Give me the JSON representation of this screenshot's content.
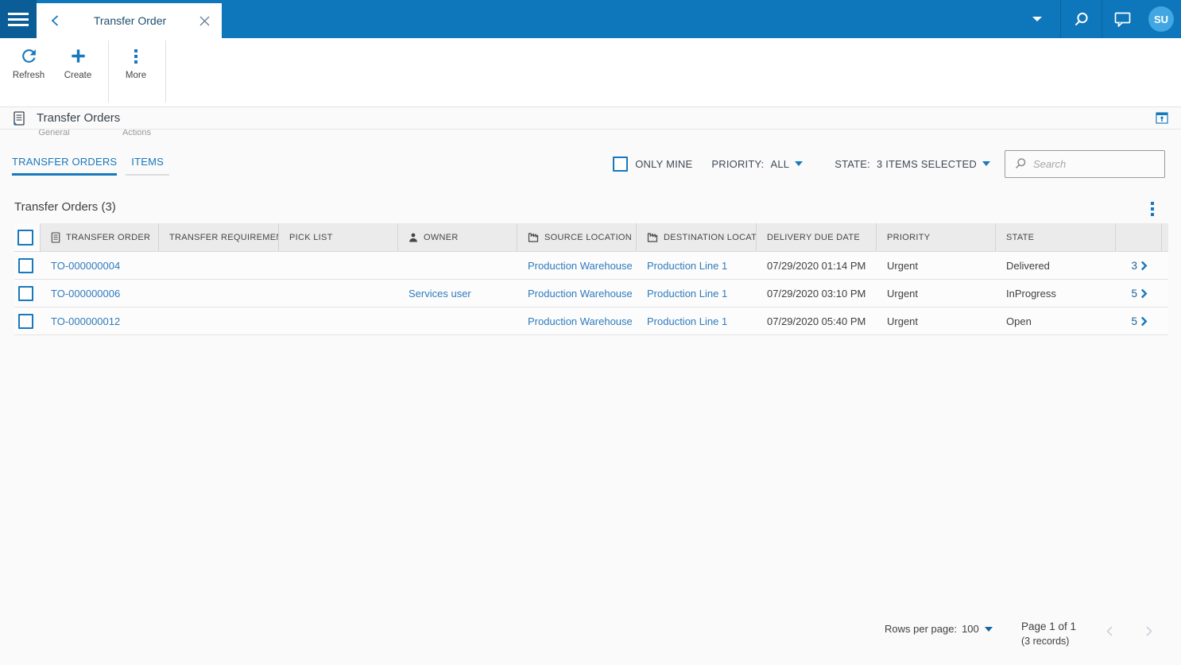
{
  "topbar": {
    "tab_title": "Transfer Order",
    "avatar_initials": "SU"
  },
  "ribbon": {
    "buttons": [
      {
        "label": "Refresh"
      },
      {
        "label": "Create"
      },
      {
        "label": "More"
      }
    ],
    "groups": [
      {
        "label": "General"
      },
      {
        "label": "Actions"
      }
    ]
  },
  "page": {
    "title": "Transfer Orders"
  },
  "tabs": [
    {
      "label": "TRANSFER ORDERS",
      "active": true
    },
    {
      "label": "ITEMS",
      "active": false
    }
  ],
  "filters": {
    "only_mine_label": "ONLY MINE",
    "priority_label": "PRIORITY:",
    "priority_value": "ALL",
    "state_label": "STATE:",
    "state_value": "3 ITEMS SELECTED",
    "search_placeholder": "Search"
  },
  "grid": {
    "title": "Transfer Orders (3)",
    "columns": [
      "TRANSFER ORDER",
      "TRANSFER REQUIREMENT",
      "PICK LIST",
      "OWNER",
      "SOURCE LOCATION",
      "DESTINATION LOCATION",
      "DELIVERY DUE DATE",
      "PRIORITY",
      "STATE"
    ],
    "rows": [
      {
        "transfer_order": "TO-000000004",
        "transfer_requirement": "",
        "pick_list": "",
        "owner": "",
        "source_location": "Production Warehouse",
        "destination_location": "Production Line 1",
        "delivery_due_date": "07/29/2020 01:14 PM",
        "priority": "Urgent",
        "state": "Delivered",
        "items_count": "3"
      },
      {
        "transfer_order": "TO-000000006",
        "transfer_requirement": "",
        "pick_list": "",
        "owner": "Services user",
        "source_location": "Production Warehouse",
        "destination_location": "Production Line 1",
        "delivery_due_date": "07/29/2020 03:10 PM",
        "priority": "Urgent",
        "state": "InProgress",
        "items_count": "5"
      },
      {
        "transfer_order": "TO-000000012",
        "transfer_requirement": "",
        "pick_list": "",
        "owner": "",
        "source_location": "Production Warehouse",
        "destination_location": "Production Line 1",
        "delivery_due_date": "07/29/2020 05:40 PM",
        "priority": "Urgent",
        "state": "Open",
        "items_count": "5"
      }
    ]
  },
  "footer": {
    "rows_per_page_label": "Rows per page:",
    "rows_per_page_value": "100",
    "page_info": "Page 1 of 1",
    "records_info": "(3 records)"
  },
  "icons": {
    "menu": "hamburger",
    "back": "chevron-left",
    "close": "x",
    "tab_list": "caret-down",
    "search": "magnifier",
    "feedback": "speech-bubble",
    "refresh": "circular-arrow",
    "create": "plus",
    "more": "vertical-dots",
    "page": "document",
    "collapse_ribbon": "window-up-arrow",
    "owner": "person",
    "location": "factory",
    "row_expand": "chevron-right",
    "grid_menu": "vertical-dots"
  },
  "colors": {
    "topbar_blue": "#0e76ba",
    "topbar_dark_blue": "#0a5d97",
    "accent_blue": "#1878bc",
    "link_blue": "#2e7bbd",
    "avatar_blue": "#41a6e1",
    "header_gray": "#ebebeb",
    "text_dark": "#404040",
    "muted_gray": "#9a9a9a"
  }
}
